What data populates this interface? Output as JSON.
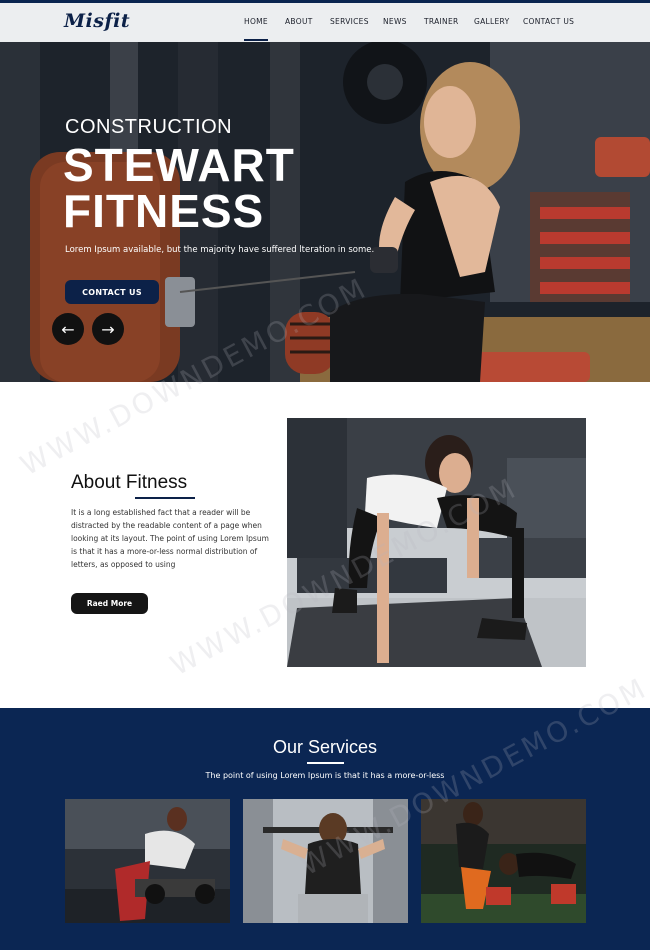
{
  "header": {
    "logo": "Misfit",
    "nav": [
      {
        "label": "HOME",
        "active": true
      },
      {
        "label": "ABOUT"
      },
      {
        "label": "SERVICES"
      },
      {
        "label": "NEWS"
      },
      {
        "label": "TRAINER"
      },
      {
        "label": "GALLERY"
      },
      {
        "label": "CONTACT US"
      }
    ]
  },
  "hero": {
    "subtitle": "CONSTRUCTION",
    "title_line1": "STEWART",
    "title_line2": "FITNESS",
    "description": "Lorem Ipsum available, but the majority have suffered lteration in some.",
    "cta": "CONTACT US",
    "prev_icon": "arrow-left-icon",
    "next_icon": "arrow-right-icon"
  },
  "about": {
    "title": "About Fitness",
    "text": "It is a long established fact that a reader will be distracted by the readable content of a page when looking at its layout. The point of using Lorem Ipsum is that it has a more-or-less normal distribution of letters, as opposed to using",
    "button": "Raed More"
  },
  "services": {
    "title": "Our Services",
    "subtitle": "The point of using Lorem Ipsum is that it has a more-or-less"
  },
  "watermark": "WWW.DOWNDEMO.COM",
  "colors": {
    "brand_navy": "#0c2148",
    "services_bg": "#0b2653",
    "header_bg": "#eceef0"
  }
}
